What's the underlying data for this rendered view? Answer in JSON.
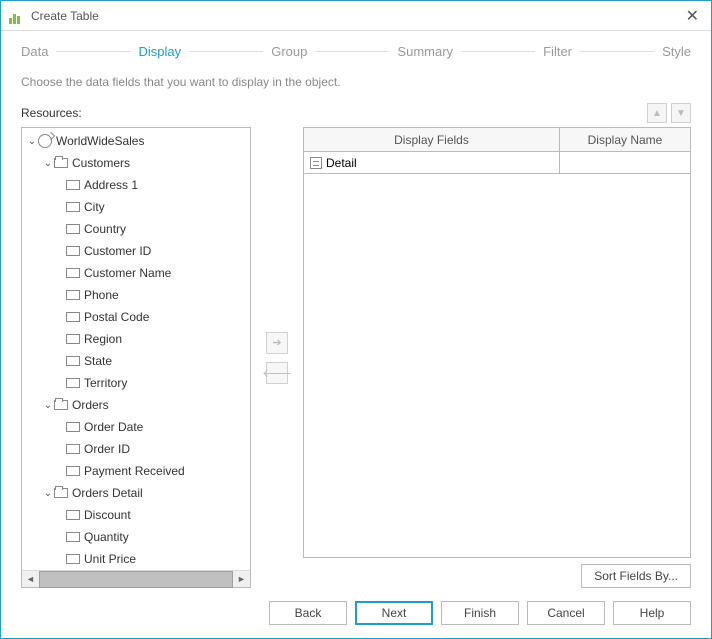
{
  "window": {
    "title": "Create Table"
  },
  "steps": [
    "Data",
    "Display",
    "Group",
    "Summary",
    "Filter",
    "Style"
  ],
  "active_step_index": 1,
  "instruction": "Choose the data fields that you want to display in the object.",
  "resources_label": "Resources:",
  "tree": {
    "root": "WorldWideSales",
    "groups": [
      {
        "name": "Customers",
        "fields": [
          "Address 1",
          "City",
          "Country",
          "Customer ID",
          "Customer Name",
          "Phone",
          "Postal Code",
          "Region",
          "State",
          "Territory"
        ]
      },
      {
        "name": "Orders",
        "fields": [
          "Order Date",
          "Order ID",
          "Payment Received"
        ]
      },
      {
        "name": "Orders Detail",
        "fields": [
          "Discount",
          "Quantity",
          "Unit Price"
        ]
      }
    ]
  },
  "table": {
    "headers": [
      "Display Fields",
      "Display Name"
    ],
    "rows": [
      {
        "field": "Detail",
        "name": ""
      }
    ]
  },
  "sort_button": "Sort Fields By...",
  "footer": {
    "back": "Back",
    "next": "Next",
    "finish": "Finish",
    "cancel": "Cancel",
    "help": "Help"
  }
}
